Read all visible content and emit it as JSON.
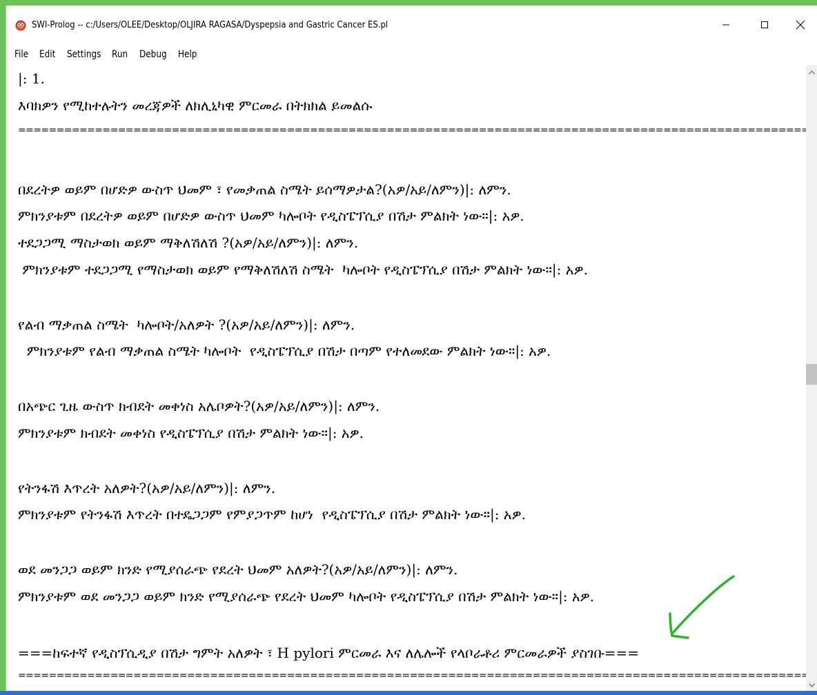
{
  "window": {
    "title": "SWI-Prolog -- c:/Users/OLEE/Desktop/OLJIRA RAGASA/Dyspepsia  and Gastric Cancer ES.pl",
    "app_icon": "owl-icon",
    "controls": {
      "minimize_icon": "minimize-icon",
      "maximize_icon": "maximize-icon",
      "close_icon": "close-icon"
    }
  },
  "menu": {
    "items": [
      "File",
      "Edit",
      "Settings",
      "Run",
      "Debug",
      "Help"
    ]
  },
  "console": {
    "lines": [
      "|: 1.",
      "እባክዎን የሚከተሉትን መረጃዎች ለክሊኒካዊ ምርመራ በትክክል ይመልሱ",
      "===================================================================================================================================",
      "በደረትዎ ወይም በሆድዎ ውስጥ ህመም ፣ የመቃጠል ስሜት ይሰማዎታል?(አዎ/አይ/ለምን)|: ለምን.",
      "ምክንያቱም በደረትዎ ወይም በሆድዎ ውስጥ ህመም ካሎቦት የዲስፔፕሲያ በሽታ ምልክት ነው።|: አዎ.",
      "ተደጋጋሚ ማስታወክ ወይም ማቅለሽለሽ ?(አዎ/አይ/ለምን)|: ለምን.",
      " ምክንያቱም ተደጋጋሚ የማስታወክ ወይም የማቅለሽለሽ ስሜት  ካሎቦት የዲስፔፕሲያ በሽታ ምልክት ነው።|: አዎ.",
      "የልብ ማቃጠል ስሜት  ካሎቦት/አለዎት ?(አዎ/አይ/ለምን)|: ለምን.",
      "  ምክንያቱም የልብ ማቃጠል ስሜት ካሎቦት  የዲስፔፕሲያ በሽታ በጣም የተለመደው ምልክት ነው።|: አዎ.",
      "በአጭር ጊዜ ውስጥ ክብደት መቀነስ አሌቦዎት?(አዎ/አይ/ለምን)|: ለምን.",
      "ምክንያቱም ክብደት መቀነስ የዲስፔፕሲያ በሽታ ምልክት ነው።|: አዎ.",
      "የትንፋሽ እጥረት አለዎት?(አዎ/አይ/ለምን)|: ለምን.",
      "ምክንያቱም የትንፋሽ እጥረት በተዴጋጋም የምያጋጥም ከሆነ  የዲስፔፕሲያ በሽታ ምልክት ነው።|: አዎ.",
      "ወደ መንጋጋ ወይም ክንድ የሚያሰራጭ የደረት ህመም አለዎት?(አዎ/አይ/ለምን)|: ለምን.",
      "ምክንያቱም ወደ መንጋጋ ወይም ክንድ የሚያሰራጭ የደረት ህመም ካሎቦት የዲስፔፕሲያ በሽታ ምልክት ነው።|: አዎ.",
      "===ከፍተኛ የዲስፕሲዲያ በሽታ ግምት አለዎት ፣ H pylori ምርመራ እና ለሌሎች የላቦራቶሪ ምርመራዎች ያስገቡ===",
      "==================================================================================================================================="
    ]
  },
  "scrollbar": {
    "up_icon": "scroll-up-arrow-icon",
    "down_icon": "scroll-down-arrow-icon"
  },
  "annotation": {
    "icon": "green-arrow-icon",
    "color": "#2fb32f"
  },
  "colors": {
    "desktop_background": "#6ac259",
    "taskbar_strip": "#2d6fd0",
    "window_background": "#ffffff",
    "text": "#000000"
  }
}
